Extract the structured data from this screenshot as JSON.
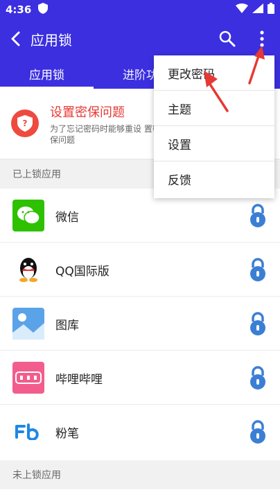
{
  "status_bar": {
    "time": "4:36"
  },
  "header": {
    "title": "应用锁"
  },
  "tabs": [
    {
      "label": "应用锁",
      "active": true
    },
    {
      "label": "进阶功",
      "active": false
    }
  ],
  "security_prompt": {
    "title": "设置密保问题",
    "description": "为了忘记密码时能够重设 置密保问题"
  },
  "sections": {
    "locked": "已上锁应用",
    "unlocked": "未上锁应用"
  },
  "apps": [
    {
      "name": "微信",
      "icon": "wechat-icon"
    },
    {
      "name": "QQ国际版",
      "icon": "qq-icon"
    },
    {
      "name": "图库",
      "icon": "gallery-icon"
    },
    {
      "name": "哔哩哔哩",
      "icon": "bilibili-icon"
    },
    {
      "name": "粉笔",
      "icon": "fenbi-icon"
    }
  ],
  "menu": {
    "items": [
      "更改密码",
      "主题",
      "设置",
      "反馈"
    ]
  },
  "colors": {
    "primary": "#3b2fe0",
    "accent_red": "#e53935",
    "lock_blue": "#3b7fd4"
  }
}
